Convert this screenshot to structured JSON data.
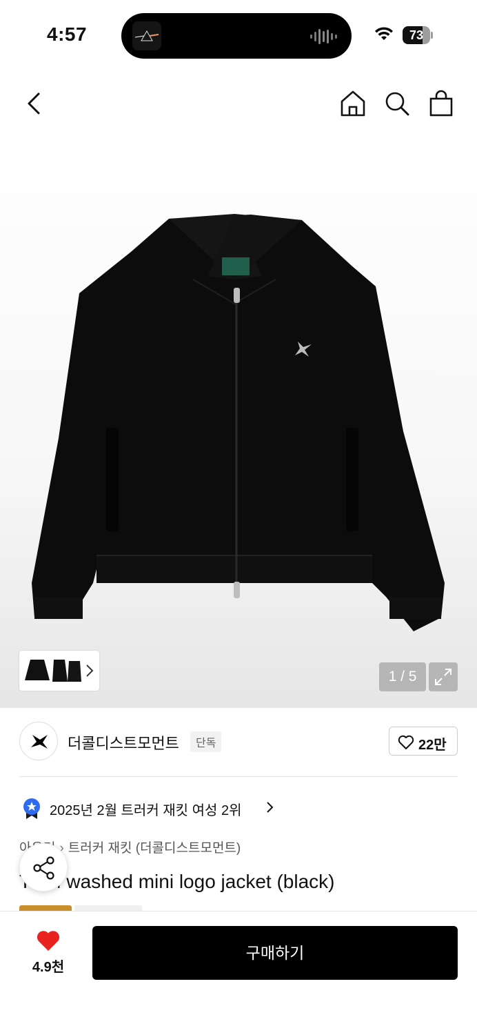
{
  "status_bar": {
    "time": "4:57",
    "battery": "73",
    "battery_level": 0.73
  },
  "nav": {
    "back_icon": "chevron-left-icon",
    "home_icon": "home-icon",
    "search_icon": "search-icon",
    "cart_icon": "shopping-bag-icon"
  },
  "gallery": {
    "counter": "1 / 5",
    "expand_icon": "expand-icon"
  },
  "brand": {
    "name": "더콜디스트모먼트",
    "exclusive_label": "단독",
    "likes": "22만"
  },
  "ranking": {
    "text": "2025년 2월 트러커 재킷 여성 2위"
  },
  "breadcrumb": {
    "category": "아우터",
    "subcategory": "트러커 재킷 (더콜디스트모먼트)"
  },
  "product": {
    "title": "TCM washed mini logo jacket (black)"
  },
  "bottom_bar": {
    "wish_count": "4.9천",
    "buy_label": "구매하기"
  },
  "colors": {
    "like_heart": "#e8231f",
    "buy_button": "#000000",
    "rank_badge": "#2f6bf0"
  }
}
